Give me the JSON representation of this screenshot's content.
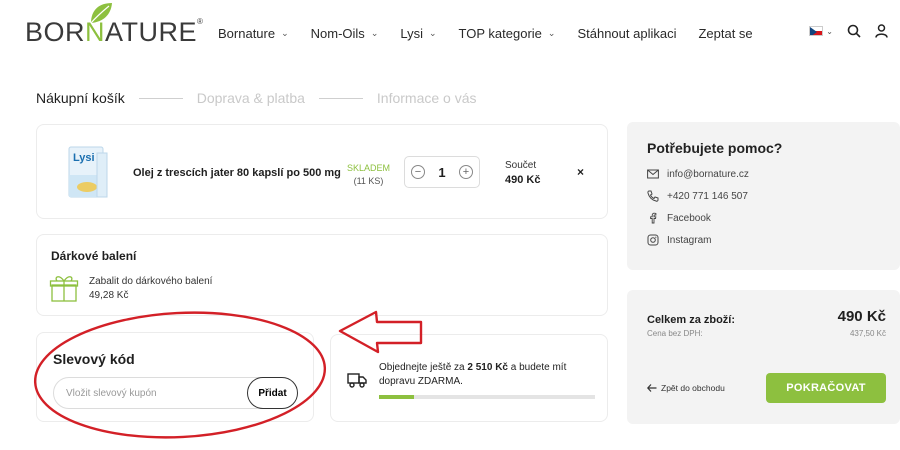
{
  "header": {
    "logo": {
      "part1": "BOR",
      "part2": "N",
      "part3": "ATURE",
      "mark": "®"
    },
    "nav": [
      {
        "label": "Bornature",
        "dropdown": true
      },
      {
        "label": "Nom-Oils",
        "dropdown": true
      },
      {
        "label": "Lysi",
        "dropdown": true
      },
      {
        "label": "TOP kategorie",
        "dropdown": true
      },
      {
        "label": "Stáhnout aplikaci",
        "dropdown": false
      },
      {
        "label": "Zeptat se",
        "dropdown": false
      }
    ],
    "icons": [
      "flag-cz-icon",
      "search-icon",
      "user-icon"
    ]
  },
  "steps": [
    {
      "label": "Nákupní košík",
      "active": true
    },
    {
      "label": "Doprava & platba",
      "active": false
    },
    {
      "label": "Informace o vás",
      "active": false
    }
  ],
  "cart": {
    "item": {
      "name": "Olej z trescích jater 80 kapslí po 500 mg",
      "brand_text": "Lysi",
      "stock_status": "SKLADEM",
      "stock_count": "(11 KS)",
      "quantity": "1",
      "sum_label": "Součet",
      "sum_value": "490 Kč",
      "remove": "×"
    }
  },
  "gift": {
    "title": "Dárkové balení",
    "option_label": "Zabalit do dárkového balení",
    "option_price": "49,28 Kč"
  },
  "coupon": {
    "title": "Slevový kód",
    "placeholder": "Vložit slevový kupón",
    "button": "Přidat"
  },
  "shipping": {
    "text_pre": "Objednejte ještě za ",
    "amount": "2 510 Kč",
    "text_post": " a budete mít dopravu ZDARMA.",
    "progress": 0.163
  },
  "help": {
    "title": "Potřebujete pomoc?",
    "email": "info@bornature.cz",
    "phone": "+420 771 146 507",
    "facebook": "Facebook",
    "instagram": "Instagram"
  },
  "totals": {
    "total_label": "Celkem za zboží:",
    "total_value": "490 Kč",
    "net_label": "Cena bez DPH:",
    "net_value": "437,50 Kč",
    "back_label": "Zpět do obchodu",
    "continue_label": "POKRAČOVAT"
  },
  "colors": {
    "accent": "#8dc03f",
    "annotation": "#d32027"
  }
}
